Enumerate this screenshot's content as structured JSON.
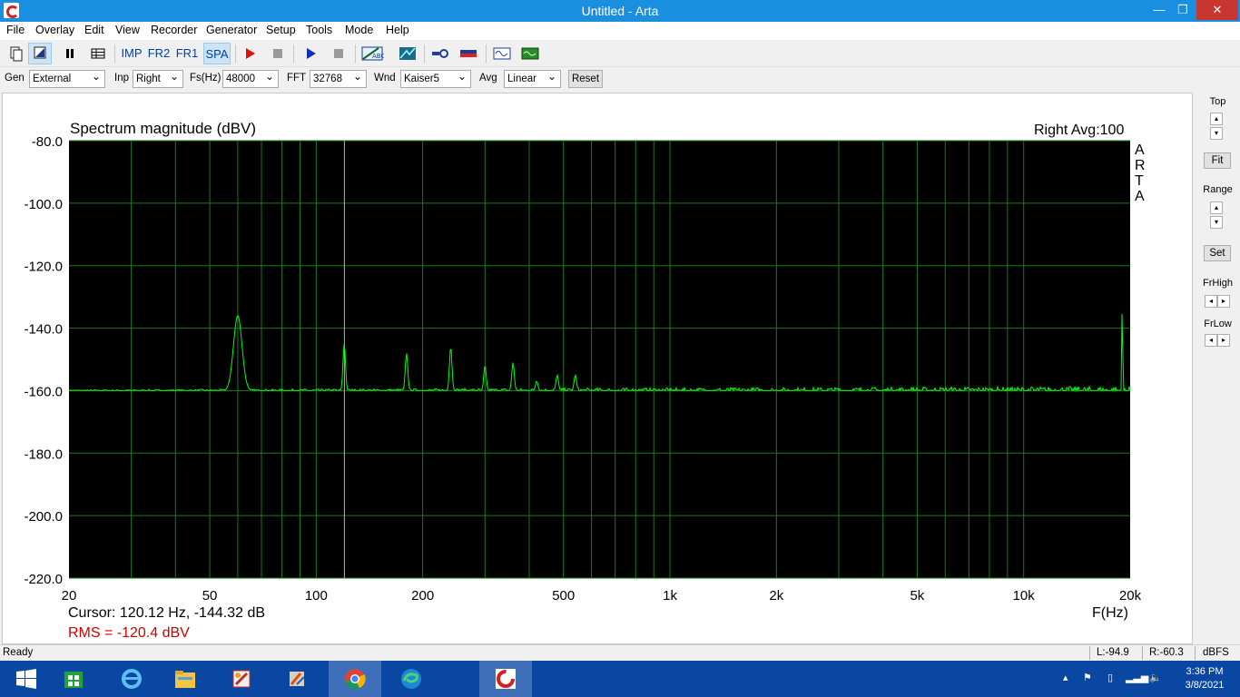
{
  "window": {
    "title": "Untitled - Arta",
    "minimize": "—",
    "maximize": "❐",
    "close": "✕"
  },
  "menu": [
    "File",
    "Overlay",
    "Edit",
    "View",
    "Recorder",
    "Generator",
    "Setup",
    "Tools",
    "Mode",
    "Help"
  ],
  "toolbar": {
    "imp": "IMP",
    "fr2": "FR2",
    "fr1": "FR1",
    "spa": "SPA"
  },
  "controls": {
    "gen_label": "Gen",
    "gen_value": "External",
    "inp_label": "Inp",
    "inp_value": "Right",
    "fs_label": "Fs(Hz)",
    "fs_value": "48000",
    "fft_label": "FFT",
    "fft_value": "32768",
    "wnd_label": "Wnd",
    "wnd_value": "Kaiser5",
    "avg_label": "Avg",
    "avg_value": "Linear",
    "reset_label": "Reset"
  },
  "right_panel": {
    "top_label": "Top",
    "fit_label": "Fit",
    "range_label": "Range",
    "set_label": "Set",
    "frhigh_label": "FrHigh",
    "frlow_label": "FrLow"
  },
  "plot": {
    "watermark": [
      "A",
      "R",
      "T",
      "A"
    ],
    "channel_avg": "Right  Avg:100",
    "cursor_text": "Cursor: 120.12 Hz, -144.32 dB",
    "rms_text": "RMS = -120.4 dBV",
    "colors": {
      "background": "#000000",
      "grid": "#1a7a1a",
      "trace": "#00ff00",
      "rms": "#d00000"
    }
  },
  "chart_data": {
    "type": "line",
    "title": "Spectrum magnitude (dBV)",
    "xlabel": "F(Hz)",
    "ylabel": "",
    "x_scale": "log",
    "xlim": [
      20,
      20000
    ],
    "ylim": [
      -220,
      -80
    ],
    "x_ticks": [
      20,
      50,
      100,
      200,
      500,
      1000,
      2000,
      5000,
      10000,
      20000
    ],
    "x_tick_labels": [
      "20",
      "50",
      "100",
      "200",
      "500",
      "1k",
      "2k",
      "5k",
      "10k",
      "20k"
    ],
    "y_ticks": [
      -80,
      -100,
      -120,
      -140,
      -160,
      -180,
      -200,
      -220
    ],
    "y_tick_labels": [
      "-80.0",
      "-100.0",
      "-120.0",
      "-140.0",
      "-160.0",
      "-180.0",
      "-200.0",
      "-220.0"
    ],
    "grid": true,
    "cursor_frequency": 120.12,
    "noise_floor": -160,
    "peaks": [
      {
        "x": 60,
        "y": -136
      },
      {
        "x": 120,
        "y": -145
      },
      {
        "x": 180,
        "y": -148
      },
      {
        "x": 240,
        "y": -146
      },
      {
        "x": 300,
        "y": -152
      },
      {
        "x": 360,
        "y": -151
      },
      {
        "x": 420,
        "y": -157
      },
      {
        "x": 480,
        "y": -155
      },
      {
        "x": 540,
        "y": -155
      },
      {
        "x": 19000,
        "y": -129
      }
    ]
  },
  "status": {
    "ready": "Ready",
    "left_level": "L:-94.9",
    "right_level": "R:-60.3",
    "unit": "dBFS"
  },
  "taskbar": {
    "time": "3:36 PM",
    "date": "3/8/2021"
  }
}
